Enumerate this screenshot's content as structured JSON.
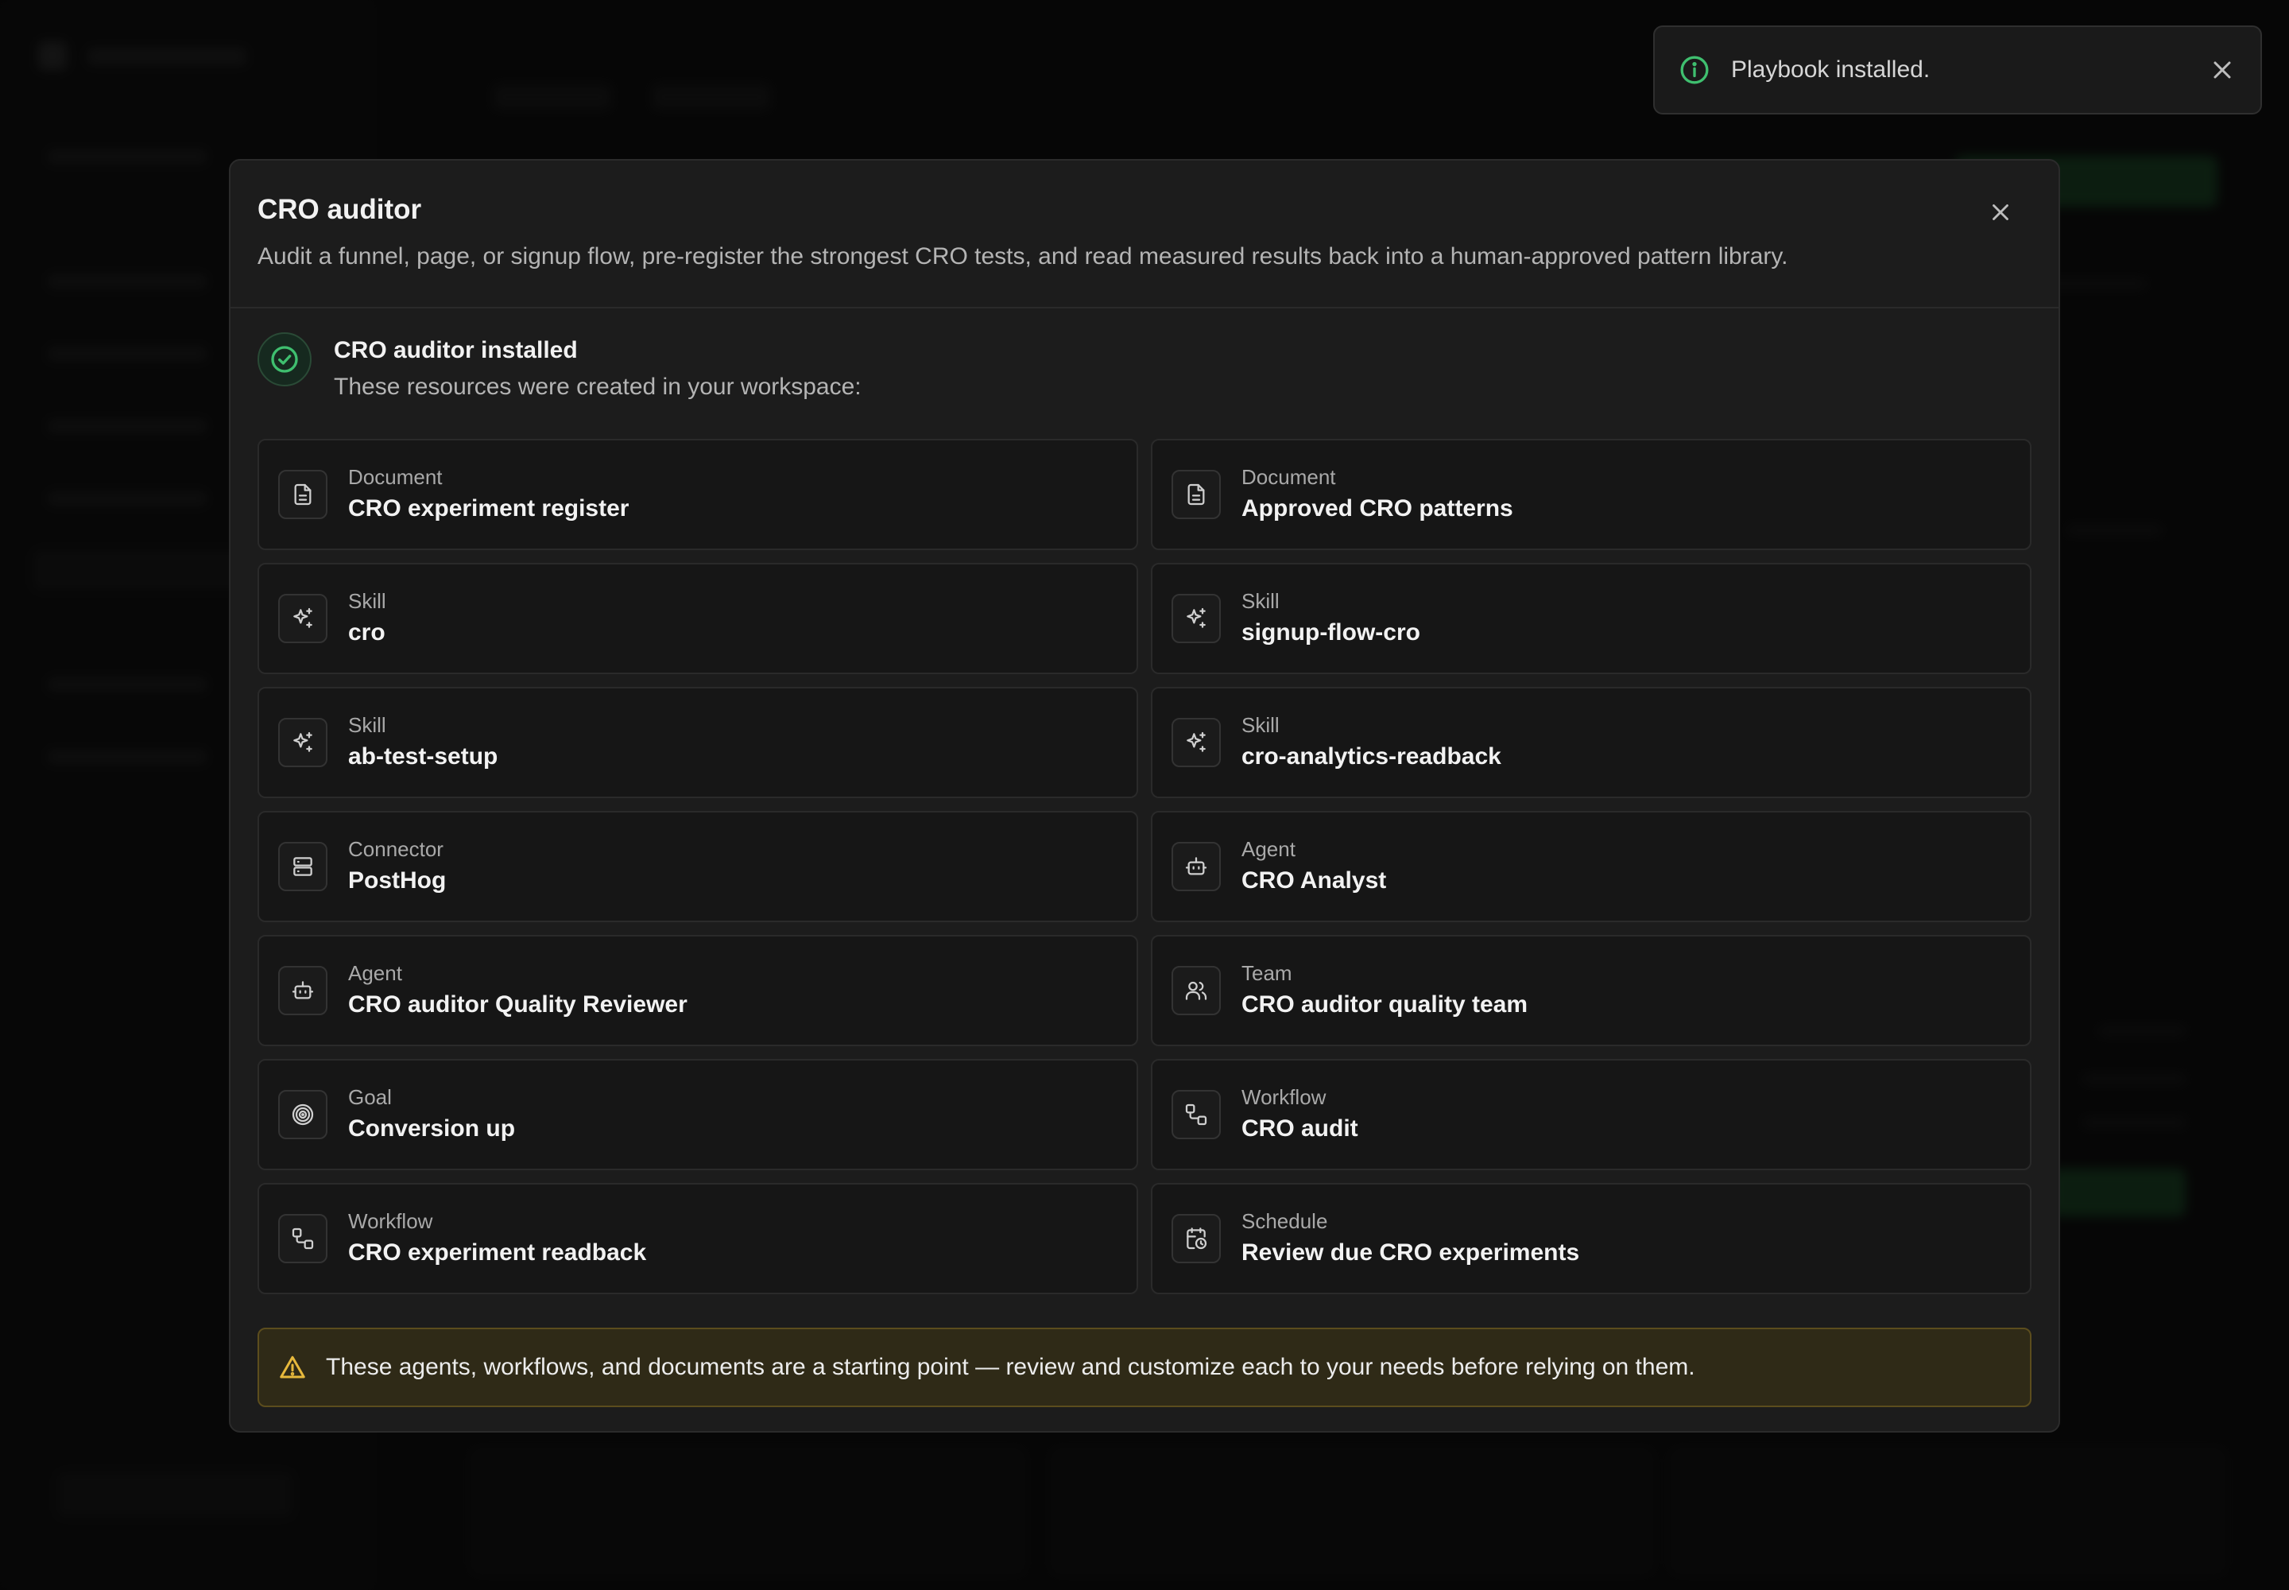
{
  "toast": {
    "message": "Playbook installed.",
    "icon": "info-icon",
    "accent": "#3fbf6f"
  },
  "modal": {
    "title": "CRO auditor",
    "description": "Audit a funnel, page, or signup flow, pre-register the strongest CRO tests, and read measured results back into a human-approved pattern library.",
    "installed_title": "CRO auditor installed",
    "installed_subtitle": "These resources were created in your workspace:",
    "resources": [
      {
        "type": "Document",
        "name": "CRO experiment register",
        "icon": "document-icon"
      },
      {
        "type": "Document",
        "name": "Approved CRO patterns",
        "icon": "document-icon"
      },
      {
        "type": "Skill",
        "name": "cro",
        "icon": "sparkles-icon"
      },
      {
        "type": "Skill",
        "name": "signup-flow-cro",
        "icon": "sparkles-icon"
      },
      {
        "type": "Skill",
        "name": "ab-test-setup",
        "icon": "sparkles-icon"
      },
      {
        "type": "Skill",
        "name": "cro-analytics-readback",
        "icon": "sparkles-icon"
      },
      {
        "type": "Connector",
        "name": "PostHog",
        "icon": "server-icon"
      },
      {
        "type": "Agent",
        "name": "CRO Analyst",
        "icon": "bot-icon"
      },
      {
        "type": "Agent",
        "name": "CRO auditor Quality Reviewer",
        "icon": "bot-icon"
      },
      {
        "type": "Team",
        "name": "CRO auditor quality team",
        "icon": "users-icon"
      },
      {
        "type": "Goal",
        "name": "Conversion up",
        "icon": "target-icon"
      },
      {
        "type": "Workflow",
        "name": "CRO audit",
        "icon": "workflow-icon"
      },
      {
        "type": "Workflow",
        "name": "CRO experiment readback",
        "icon": "workflow-icon"
      },
      {
        "type": "Schedule",
        "name": "Review due CRO experiments",
        "icon": "calendar-clock-icon"
      }
    ],
    "warning": "These agents, workflows, and documents are a starting point — review and customize each to your needs before relying on them.",
    "colors": {
      "success": "#3fbf6f",
      "warning_bg": "#2f2a17",
      "warning_border": "#5c4d1d",
      "warning_icon": "#e7b93c"
    }
  }
}
